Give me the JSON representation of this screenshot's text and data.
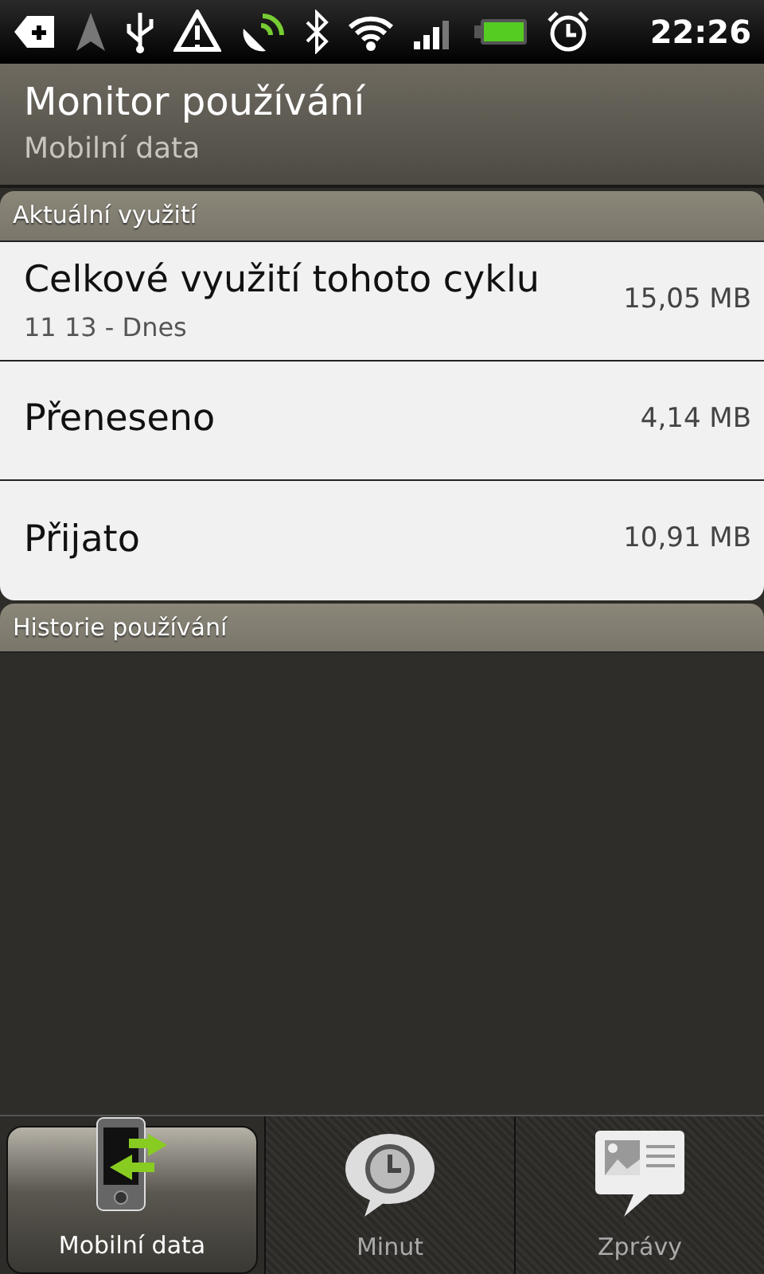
{
  "status_bar": {
    "time": "22:26"
  },
  "header": {
    "title": "Monitor používání",
    "subtitle": "Mobilní data"
  },
  "sections": [
    {
      "title": "Aktuální využití",
      "rows": [
        {
          "label": "Celkové využití tohoto cyklu",
          "detail": "11 13 - Dnes",
          "value": "15,05 MB"
        },
        {
          "label": "Přeneseno",
          "value": "4,14 MB"
        },
        {
          "label": "Přijato",
          "value": "10,91 MB"
        }
      ]
    },
    {
      "title": "Historie používání"
    }
  ],
  "tabs": [
    {
      "label": "Mobilní data",
      "kind": "data",
      "selected": true
    },
    {
      "label": "Minut",
      "kind": "clock",
      "selected": false
    },
    {
      "label": "Zprávy",
      "kind": "message",
      "selected": false
    }
  ]
}
